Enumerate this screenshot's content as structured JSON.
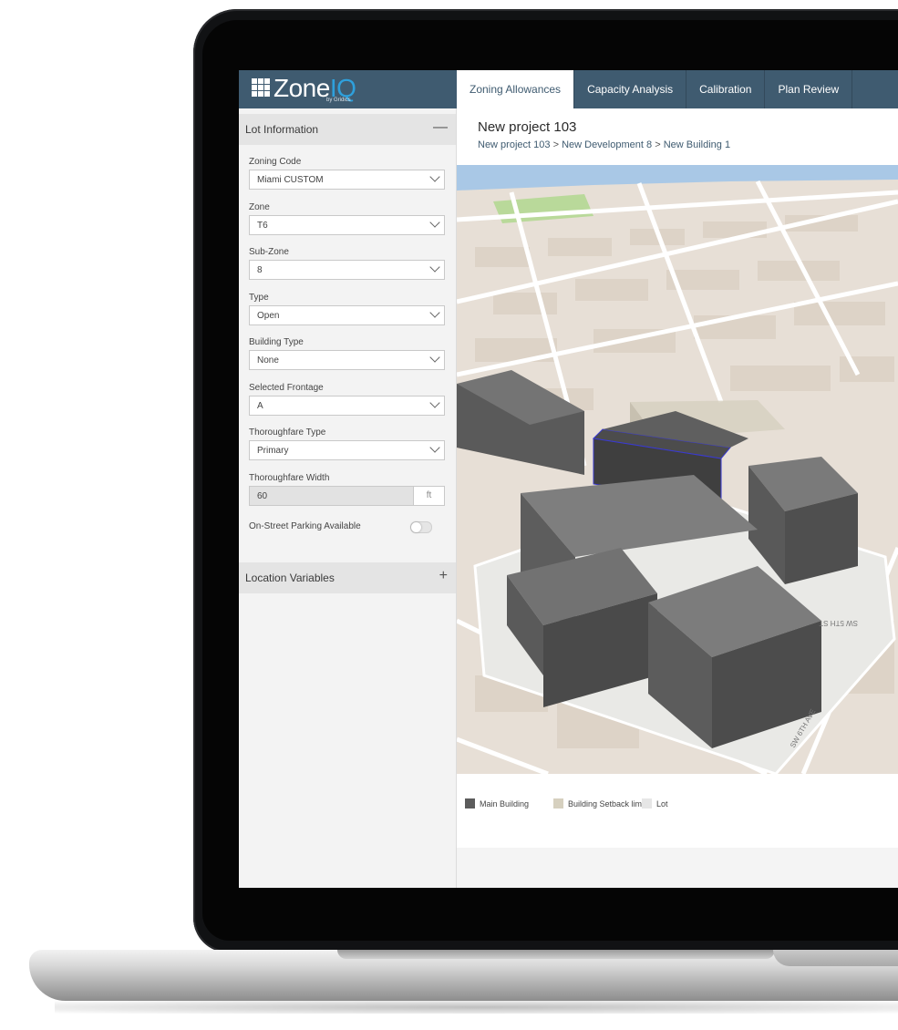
{
  "app": {
    "logo_main": "Zone",
    "logo_accent": "IQ",
    "logo_sub": "by Gridics"
  },
  "tabs": [
    {
      "label": "Zoning Allowances",
      "active": true
    },
    {
      "label": "Capacity Analysis",
      "active": false
    },
    {
      "label": "Calibration",
      "active": false
    },
    {
      "label": "Plan Review",
      "active": false
    }
  ],
  "sidebar": {
    "lot_information": {
      "title": "Lot Information",
      "toggle": "—",
      "fields": {
        "zoning_code": {
          "label": "Zoning Code",
          "value": "Miami CUSTOM"
        },
        "zone": {
          "label": "Zone",
          "value": "T6"
        },
        "sub_zone": {
          "label": "Sub-Zone",
          "value": "8"
        },
        "type": {
          "label": "Type",
          "value": "Open"
        },
        "building_type": {
          "label": "Building Type",
          "value": "None"
        },
        "selected_frontage": {
          "label": "Selected Frontage",
          "value": "A"
        },
        "thoroughfare_type": {
          "label": "Thoroughfare Type",
          "value": "Primary"
        },
        "thoroughfare_width": {
          "label": "Thoroughfare Width",
          "value": "60",
          "unit": "ft"
        },
        "on_street_parking": {
          "label": "On-Street Parking Available",
          "enabled": false
        }
      }
    },
    "location_variables": {
      "title": "Location Variables",
      "toggle": "+"
    }
  },
  "main": {
    "project_title": "New project 103",
    "breadcrumb": {
      "project": "New project 103",
      "sep": ">",
      "development": "New Development 8",
      "building": "New Building 1"
    },
    "map": {
      "street_labels": [
        "SW 6TH AVE",
        "SW 5TH ST"
      ]
    },
    "legend": [
      {
        "label": "Main Building",
        "color": "#5c5c5c"
      },
      {
        "label": "Building Setback limit",
        "color": "#d6d0bf"
      },
      {
        "label": "Lot",
        "color": "#e6e6e6"
      }
    ]
  },
  "colors": {
    "header": "#3f5b70",
    "accent": "#2ea0dc",
    "water": "#a9c8e6",
    "park": "#b9d99a",
    "road": "#ffffff",
    "ground": "#e7dfd6",
    "building_top": "#707070",
    "building_side": "#5a5a5a"
  }
}
